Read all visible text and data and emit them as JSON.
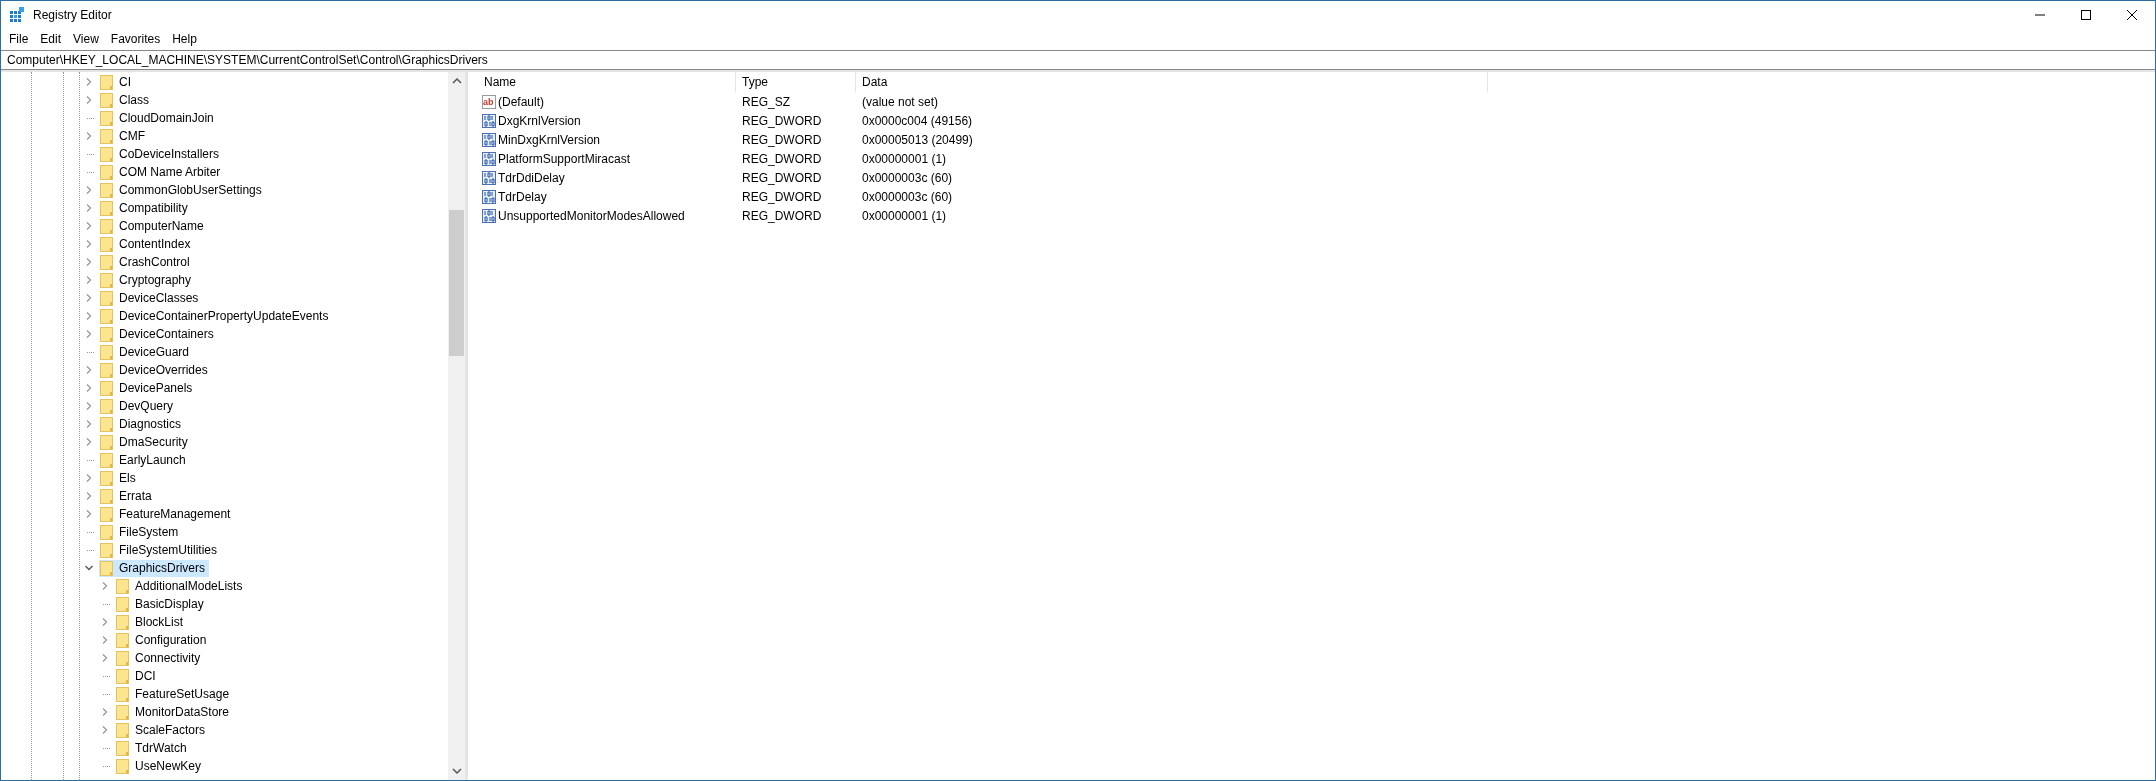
{
  "window": {
    "title": "Registry Editor"
  },
  "menu": [
    "File",
    "Edit",
    "View",
    "Favorites",
    "Help"
  ],
  "address": "Computer\\HKEY_LOCAL_MACHINE\\SYSTEM\\CurrentControlSet\\Control\\GraphicsDrivers",
  "tree": {
    "items": [
      {
        "label": "CI",
        "has_children": true,
        "expanded": false,
        "selected": false
      },
      {
        "label": "Class",
        "has_children": true,
        "expanded": false,
        "selected": false
      },
      {
        "label": "CloudDomainJoin",
        "has_children": false,
        "expanded": false,
        "selected": false
      },
      {
        "label": "CMF",
        "has_children": true,
        "expanded": false,
        "selected": false
      },
      {
        "label": "CoDeviceInstallers",
        "has_children": false,
        "expanded": false,
        "selected": false
      },
      {
        "label": "COM Name Arbiter",
        "has_children": false,
        "expanded": false,
        "selected": false
      },
      {
        "label": "CommonGlobUserSettings",
        "has_children": true,
        "expanded": false,
        "selected": false
      },
      {
        "label": "Compatibility",
        "has_children": true,
        "expanded": false,
        "selected": false
      },
      {
        "label": "ComputerName",
        "has_children": true,
        "expanded": false,
        "selected": false
      },
      {
        "label": "ContentIndex",
        "has_children": true,
        "expanded": false,
        "selected": false
      },
      {
        "label": "CrashControl",
        "has_children": true,
        "expanded": false,
        "selected": false
      },
      {
        "label": "Cryptography",
        "has_children": true,
        "expanded": false,
        "selected": false
      },
      {
        "label": "DeviceClasses",
        "has_children": true,
        "expanded": false,
        "selected": false
      },
      {
        "label": "DeviceContainerPropertyUpdateEvents",
        "has_children": true,
        "expanded": false,
        "selected": false
      },
      {
        "label": "DeviceContainers",
        "has_children": true,
        "expanded": false,
        "selected": false
      },
      {
        "label": "DeviceGuard",
        "has_children": false,
        "expanded": false,
        "selected": false
      },
      {
        "label": "DeviceOverrides",
        "has_children": true,
        "expanded": false,
        "selected": false
      },
      {
        "label": "DevicePanels",
        "has_children": true,
        "expanded": false,
        "selected": false
      },
      {
        "label": "DevQuery",
        "has_children": true,
        "expanded": false,
        "selected": false
      },
      {
        "label": "Diagnostics",
        "has_children": true,
        "expanded": false,
        "selected": false
      },
      {
        "label": "DmaSecurity",
        "has_children": true,
        "expanded": false,
        "selected": false
      },
      {
        "label": "EarlyLaunch",
        "has_children": false,
        "expanded": false,
        "selected": false
      },
      {
        "label": "Els",
        "has_children": true,
        "expanded": false,
        "selected": false
      },
      {
        "label": "Errata",
        "has_children": true,
        "expanded": false,
        "selected": false
      },
      {
        "label": "FeatureManagement",
        "has_children": true,
        "expanded": false,
        "selected": false
      },
      {
        "label": "FileSystem",
        "has_children": false,
        "expanded": false,
        "selected": false
      },
      {
        "label": "FileSystemUtilities",
        "has_children": false,
        "expanded": false,
        "selected": false
      },
      {
        "label": "GraphicsDrivers",
        "has_children": true,
        "expanded": true,
        "selected": true,
        "children": [
          {
            "label": "AdditionalModeLists",
            "has_children": true,
            "expanded": false,
            "selected": false
          },
          {
            "label": "BasicDisplay",
            "has_children": false,
            "expanded": false,
            "selected": false
          },
          {
            "label": "BlockList",
            "has_children": true,
            "expanded": false,
            "selected": false
          },
          {
            "label": "Configuration",
            "has_children": true,
            "expanded": false,
            "selected": false
          },
          {
            "label": "Connectivity",
            "has_children": true,
            "expanded": false,
            "selected": false
          },
          {
            "label": "DCI",
            "has_children": false,
            "expanded": false,
            "selected": false
          },
          {
            "label": "FeatureSetUsage",
            "has_children": false,
            "expanded": false,
            "selected": false
          },
          {
            "label": "MonitorDataStore",
            "has_children": true,
            "expanded": false,
            "selected": false
          },
          {
            "label": "ScaleFactors",
            "has_children": true,
            "expanded": false,
            "selected": false
          },
          {
            "label": "TdrWatch",
            "has_children": false,
            "expanded": false,
            "selected": false
          },
          {
            "label": "UseNewKey",
            "has_children": false,
            "expanded": false,
            "selected": false
          }
        ]
      }
    ]
  },
  "values": {
    "columns": [
      "Name",
      "Type",
      "Data"
    ],
    "rows": [
      {
        "kind": "string",
        "icon": "ab",
        "name": "(Default)",
        "type": "REG_SZ",
        "data": "(value not set)"
      },
      {
        "kind": "binary",
        "name": "DxgKrnlVersion",
        "type": "REG_DWORD",
        "data": "0x0000c004 (49156)"
      },
      {
        "kind": "binary",
        "name": "MinDxgKrnlVersion",
        "type": "REG_DWORD",
        "data": "0x00005013 (20499)"
      },
      {
        "kind": "binary",
        "name": "PlatformSupportMiracast",
        "type": "REG_DWORD",
        "data": "0x00000001 (1)"
      },
      {
        "kind": "binary",
        "name": "TdrDdiDelay",
        "type": "REG_DWORD",
        "data": "0x0000003c (60)"
      },
      {
        "kind": "binary",
        "name": "TdrDelay",
        "type": "REG_DWORD",
        "data": "0x0000003c (60)"
      },
      {
        "kind": "binary",
        "name": "UnsupportedMonitorModesAllowed",
        "type": "REG_DWORD",
        "data": "0x00000001 (1)"
      }
    ]
  }
}
